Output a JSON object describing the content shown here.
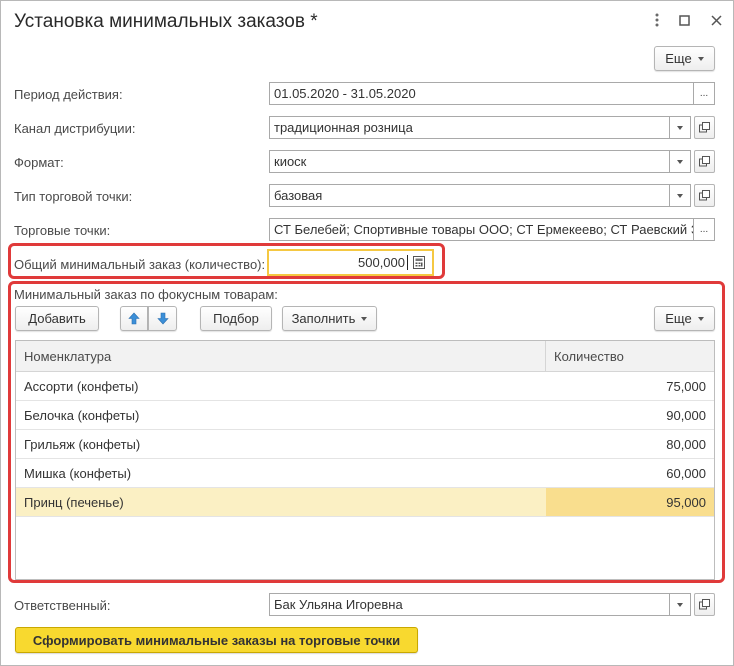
{
  "window": {
    "title": "Установка минимальных заказов *",
    "more_label": "Еще"
  },
  "form": {
    "period": {
      "label": "Период действия:",
      "value": "01.05.2020 - 31.05.2020",
      "button": "..."
    },
    "channel": {
      "label": "Канал дистрибуции:",
      "value": "традиционная розница"
    },
    "format": {
      "label": "Формат:",
      "value": "киоск"
    },
    "point_type": {
      "label": "Тип торговой точки:",
      "value": "базовая"
    },
    "points": {
      "label": "Торговые точки:",
      "value": "СТ Белебей; Спортивные товары ООО; СТ Ермекеево; СТ Раевский Э",
      "button": "..."
    },
    "total_min_order": {
      "label": "Общий минимальный заказ (количество):",
      "value": "500,000"
    }
  },
  "focus_group": {
    "title": "Минимальный заказ по фокусным товарам:",
    "add_label": "Добавить",
    "pick_label": "Подбор",
    "fill_label": "Заполнить",
    "more_label": "Еще",
    "table": {
      "columns": [
        "Номенклатура",
        "Количество"
      ],
      "rows": [
        {
          "item": "Ассорти (конфеты)",
          "qty": "75,000"
        },
        {
          "item": "Белочка (конфеты)",
          "qty": "90,000"
        },
        {
          "item": "Грильяж (конфеты)",
          "qty": "80,000"
        },
        {
          "item": "Мишка (конфеты)",
          "qty": "60,000"
        },
        {
          "item": "Принц (печенье)",
          "qty": "95,000"
        }
      ]
    }
  },
  "responsible": {
    "label": "Ответственный:",
    "value": "Бак Ульяна Игоревна"
  },
  "submit_label": "Сформировать минимальные заказы на торговые точки",
  "colors": {
    "highlight": "#e03a3a",
    "active_field_border": "#f5c842",
    "selected_row": "#fbf0c4",
    "selected_cell": "#f9de8e",
    "primary_button": "#f8d92f",
    "arrow_icon": "#3b8fd8"
  }
}
